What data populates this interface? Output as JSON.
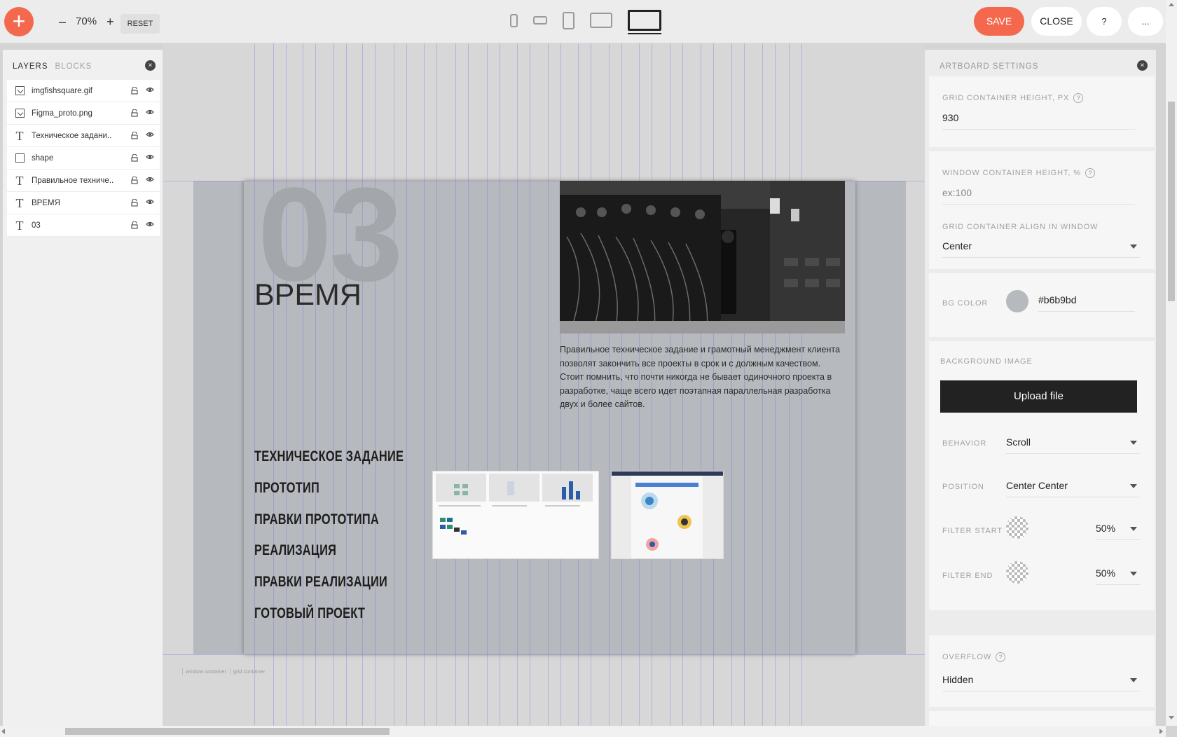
{
  "topbar": {
    "add_label": "+",
    "zoom_minus": "–",
    "zoom_value": "70%",
    "zoom_plus": "+",
    "reset_label": "RESET",
    "save_label": "SAVE",
    "close_label": "CLOSE",
    "help_label": "?",
    "more_label": "...",
    "devices": [
      "phone-portrait",
      "phone-landscape",
      "tablet-portrait",
      "tablet-landscape",
      "desktop"
    ],
    "active_device": "desktop"
  },
  "left_panel": {
    "tab_layers": "LAYERS",
    "tab_blocks": "BLOCKS",
    "layers": [
      {
        "name": "imgfishsquare.gif",
        "type": "image"
      },
      {
        "name": "Figma_proto.png",
        "type": "image"
      },
      {
        "name": "Техническое задани..",
        "type": "text"
      },
      {
        "name": "shape",
        "type": "shape"
      },
      {
        "name": "Правильное техниче..",
        "type": "text"
      },
      {
        "name": "ВРЕМЯ",
        "type": "text"
      },
      {
        "name": "03",
        "type": "text"
      }
    ]
  },
  "artboard": {
    "number": "03",
    "title": "ВРЕМЯ",
    "description": "Правильное техническое задание и грамотный менеджмент клиента позволят закончить все проекты в срок и с должным качеством. Стоит помнить, что почти никогда не бывает одиночного проекта в разработке, чаще всего идет поэтапная параллельная разработка двух и более сайтов.",
    "steps": [
      "ТЕХНИЧЕСКОЕ ЗАДАНИЕ",
      "ПРОТОТИП",
      "ПРАВКИ ПРОТОТИПА",
      "РЕАЛИЗАЦИЯ",
      "ПРАВКИ РЕАЛИЗАЦИИ",
      "ГОТОВЫЙ ПРОЕКТ"
    ],
    "label_window": "window container",
    "label_grid": "grid container"
  },
  "right_panel": {
    "title": "ARTBOARD SETTINGS",
    "grid_height_label": "GRID CONTAINER HEIGHT, PX",
    "grid_height_value": "930",
    "window_height_label": "WINDOW CONTAINER HEIGHT, %",
    "window_height_placeholder": "ex:100",
    "align_label": "GRID CONTAINER ALIGN IN WINDOW",
    "align_value": "Center",
    "bg_color_label": "BG COLOR",
    "bg_color_value": "#b6b9bd",
    "bg_image_label": "BACKGROUND IMAGE",
    "upload_label": "Upload file",
    "behavior_label": "BEHAVIOR",
    "behavior_value": "Scroll",
    "position_label": "POSITION",
    "position_value": "Center Center",
    "filter_start_label": "FILTER START",
    "filter_start_value": "50%",
    "filter_end_label": "FILTER END",
    "filter_end_value": "50%",
    "overflow_label": "OVERFLOW",
    "overflow_value": "Hidden",
    "help_glyph": "?"
  },
  "colors": {
    "accent": "#f4694d",
    "artboard_bg": "#b6b9bd",
    "grid_line": "#786edc"
  }
}
